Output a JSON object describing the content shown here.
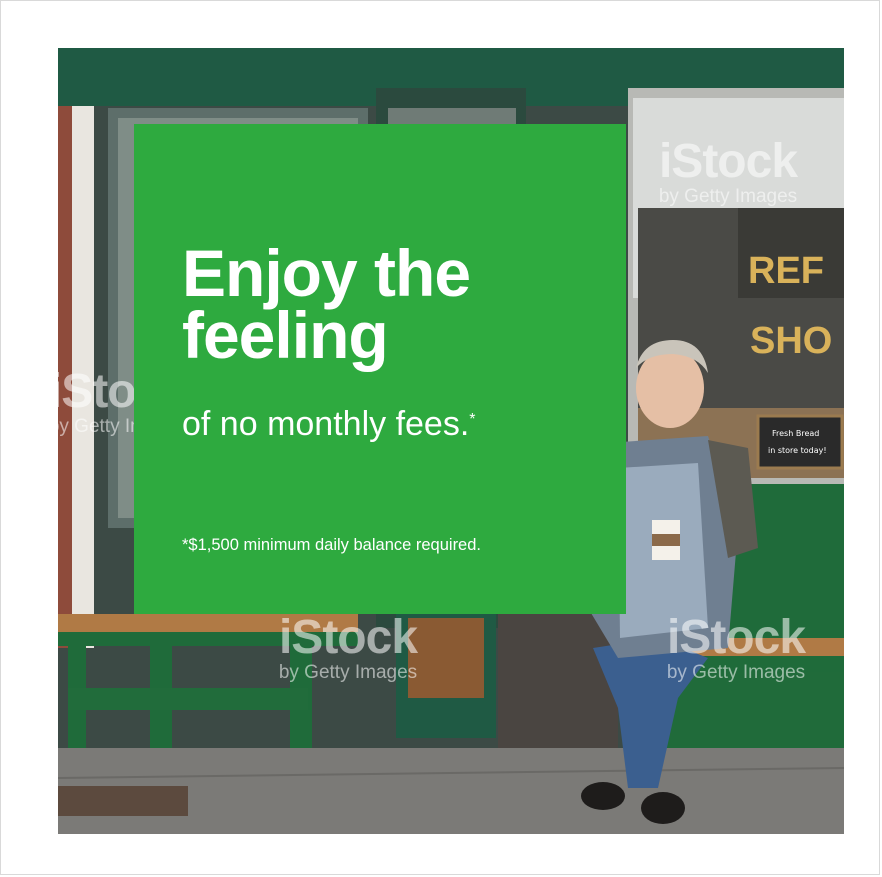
{
  "promo": {
    "headline_line1": "Enjoy the",
    "headline_line2": "feeling",
    "subline": "of no monthly fees.",
    "subline_mark": "*",
    "disclaimer": "*$1,500 minimum daily balance required."
  },
  "photo": {
    "shop_sign_fragment_1": "REF",
    "shop_sign_fragment_2": "SHO",
    "chalkboard_line1": "Fresh Bread",
    "chalkboard_line2": "in store today!"
  },
  "watermark": {
    "logo": "iStock",
    "byline": "by Getty Images"
  },
  "colors": {
    "promo_green": "#2eaa3f",
    "bench_green": "#1f6b3a",
    "text": "#ffffff"
  }
}
